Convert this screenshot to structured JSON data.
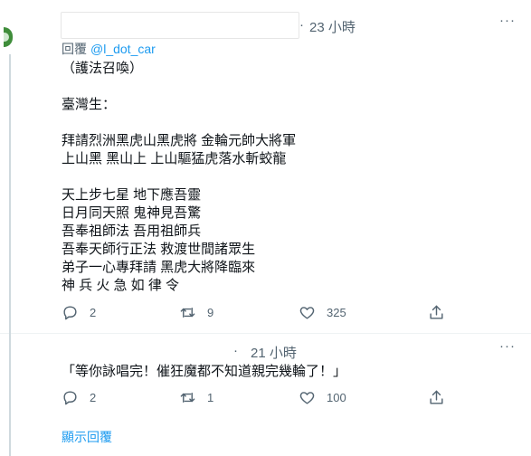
{
  "tweet": {
    "time": "23 小時",
    "dot": "·",
    "more": "···",
    "reply_prefix": "回覆",
    "reply_handle": "@l_dot_car",
    "body": "（護法召喚）\n\n臺灣生：\n\n拜請烈洲黑虎山黑虎將 金輪元帥大將軍\n上山黑 黑山上 上山驅猛虎落水斬蛟龍\n\n天上步七星 地下應吾靈\n日月同天照 鬼神見吾驚\n吾奉祖師法 吾用祖師兵\n吾奉天師行正法 救渡世間諸眾生\n弟子一心專拜請 黑虎大將降臨來\n神 兵 火 急 如 律 令",
    "actions": {
      "replies": "2",
      "retweets": "9",
      "likes": "325"
    }
  },
  "reply": {
    "time": "21 小時",
    "dot": "·",
    "more": "···",
    "body": "「等你詠唱完！催狂魔都不知道親完幾輪了！」",
    "actions": {
      "replies": "2",
      "retweets": "1",
      "likes": "100"
    }
  },
  "show_replies": "顯示回覆",
  "colors": {
    "accent": "#1d9bf0",
    "muted": "#536471",
    "text": "#0f1419",
    "divider": "#eff3f4"
  }
}
